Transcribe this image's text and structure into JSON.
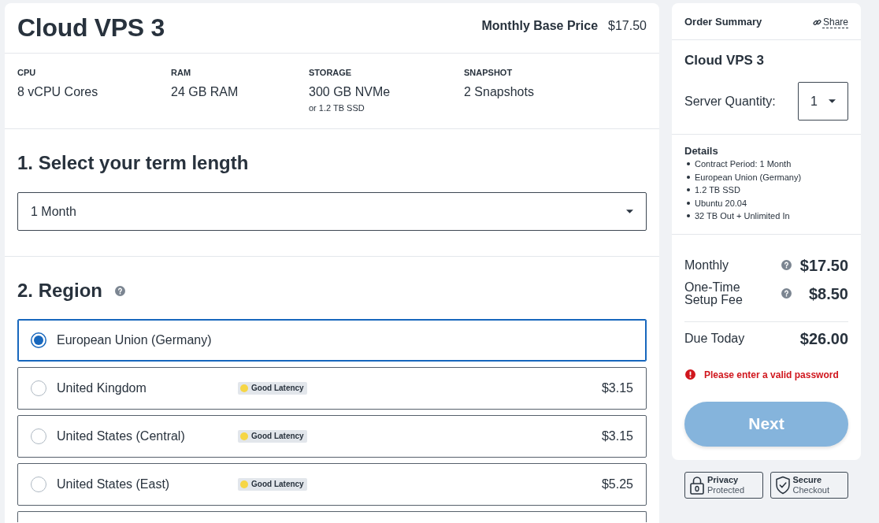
{
  "product": {
    "title": "Cloud VPS 3",
    "base_price_label": "Monthly Base Price",
    "base_price": "$17.50"
  },
  "specs": [
    {
      "label": "CPU",
      "value": "8 vCPU Cores"
    },
    {
      "label": "RAM",
      "value": "24 GB RAM"
    },
    {
      "label": "STORAGE",
      "value": "300 GB NVMe",
      "note": "or 1.2 TB SSD"
    },
    {
      "label": "SNAPSHOT",
      "value": "2 Snapshots"
    }
  ],
  "term": {
    "heading": "1. Select your term length",
    "value": "1 Month"
  },
  "region": {
    "heading": "2. Region",
    "options": [
      {
        "kind": "option",
        "name": "European Union (Germany)",
        "selected": true
      },
      {
        "kind": "option",
        "name": "United Kingdom",
        "badge": "Good Latency",
        "price": "$3.15",
        "selected": false
      },
      {
        "kind": "option",
        "name": "United States (Central)",
        "badge": "Good Latency",
        "price": "$3.15",
        "selected": false
      },
      {
        "kind": "option",
        "name": "United States (East)",
        "badge": "Good Latency",
        "price": "$5.25",
        "selected": false
      },
      {
        "kind": "cut-off",
        "selected": false
      }
    ]
  },
  "summary": {
    "title": "Order Summary",
    "share": "Share",
    "product": "Cloud VPS 3",
    "quantity_label": "Server Quantity:",
    "quantity": "1",
    "details_heading": "Details",
    "details": [
      "Contract Period: 1 Month",
      "European Union (Germany)",
      "1.2 TB SSD",
      "Ubuntu 20.04",
      "32 TB Out + Unlimited In"
    ],
    "prices": [
      {
        "label": "Monthly",
        "value": "$17.50"
      },
      {
        "label": "One-Time Setup Fee",
        "value": "$8.50"
      }
    ],
    "total_label": "Due Today",
    "total": "$26.00",
    "error": "Please enter a valid password",
    "next": {
      "label": "Next",
      "disabled": true
    }
  },
  "trust_badges": [
    {
      "kind": "lock",
      "title": "Privacy",
      "subtitle": "Protected"
    },
    {
      "kind": "shield",
      "title": "Secure",
      "subtitle": "Checkout"
    }
  ]
}
